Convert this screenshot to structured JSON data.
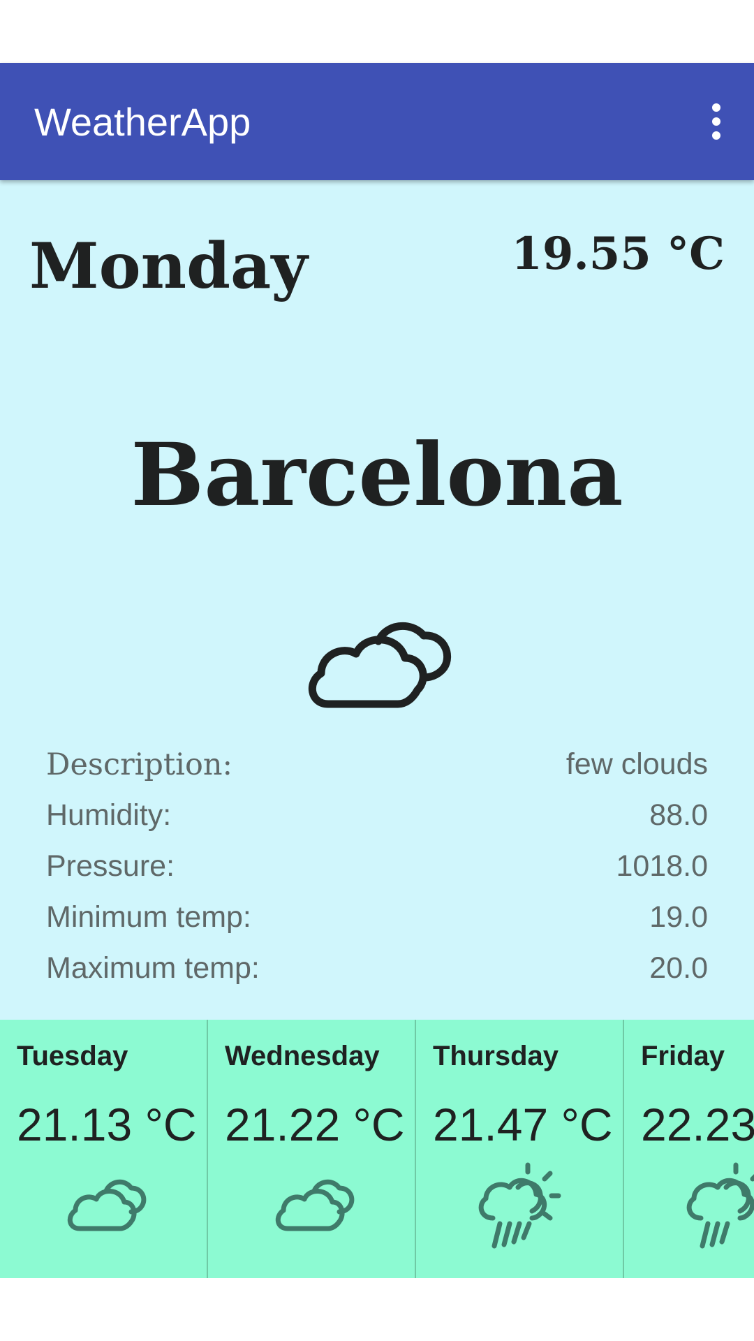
{
  "app": {
    "title": "WeatherApp",
    "menu_icon": "more-vert-icon"
  },
  "colors": {
    "appbar": "#3f51b5",
    "main_bg": "#d0f6fc",
    "forecast_bg": "#8cfad2",
    "text": "#1f2121",
    "muted": "#5f6868",
    "icon_forecast": "#3f7a6a"
  },
  "current": {
    "day": "Monday",
    "temp": "19.55 °C",
    "city": "Barcelona",
    "icon": "cloud-icon",
    "details": [
      {
        "label": "Description:",
        "value": "few clouds"
      },
      {
        "label": "Humidity:",
        "value": "88.0"
      },
      {
        "label": "Pressure:",
        "value": "1018.0"
      },
      {
        "label": "Minimum temp:",
        "value": "19.0"
      },
      {
        "label": "Maximum temp:",
        "value": "20.0"
      }
    ]
  },
  "forecast": [
    {
      "day": "Tuesday",
      "temp": "21.13 °C",
      "icon": "cloud-icon"
    },
    {
      "day": "Wednesday",
      "temp": "21.22 °C",
      "icon": "cloud-icon"
    },
    {
      "day": "Thursday",
      "temp": "21.47 °C",
      "icon": "sun-rain-icon"
    },
    {
      "day": "Friday",
      "temp": "22.23",
      "icon": "sun-rain-icon"
    }
  ]
}
